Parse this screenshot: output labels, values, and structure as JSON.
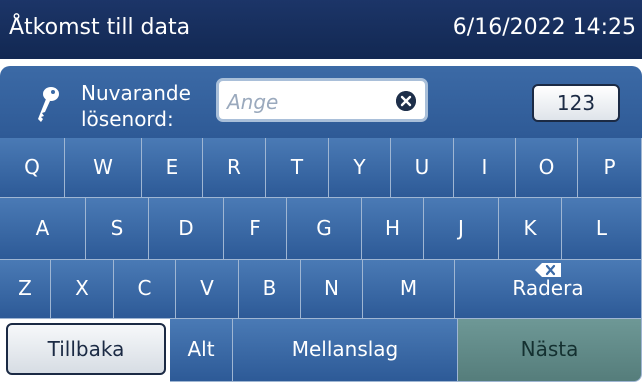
{
  "header": {
    "title": "Åtkomst till data",
    "datetime": "6/16/2022 14:25"
  },
  "password": {
    "label_line1": "Nuvarande",
    "label_line2": "lösenord:",
    "placeholder": "Ange",
    "mode_button": "123"
  },
  "keyboard": {
    "row1": [
      "Q",
      "W",
      "E",
      "R",
      "T",
      "Y",
      "U",
      "I",
      "O",
      "P"
    ],
    "row2": [
      "A",
      "S",
      "D",
      "F",
      "G",
      "H",
      "J",
      "K",
      "L"
    ],
    "row3": [
      "Z",
      "X",
      "C",
      "V",
      "B",
      "N",
      "M"
    ],
    "delete_label": "Radera",
    "back_label": "Tillbaka",
    "alt_label": "Alt",
    "space_label": "Mellanslag",
    "next_label": "Nästa"
  },
  "colors": {
    "titlebar": "#1c3568",
    "key": "#3b6aa6",
    "next": "#6a9492"
  },
  "icons": {
    "key_icon": "key-icon",
    "clear_icon": "clear-icon",
    "backspace_icon": "backspace-icon"
  }
}
